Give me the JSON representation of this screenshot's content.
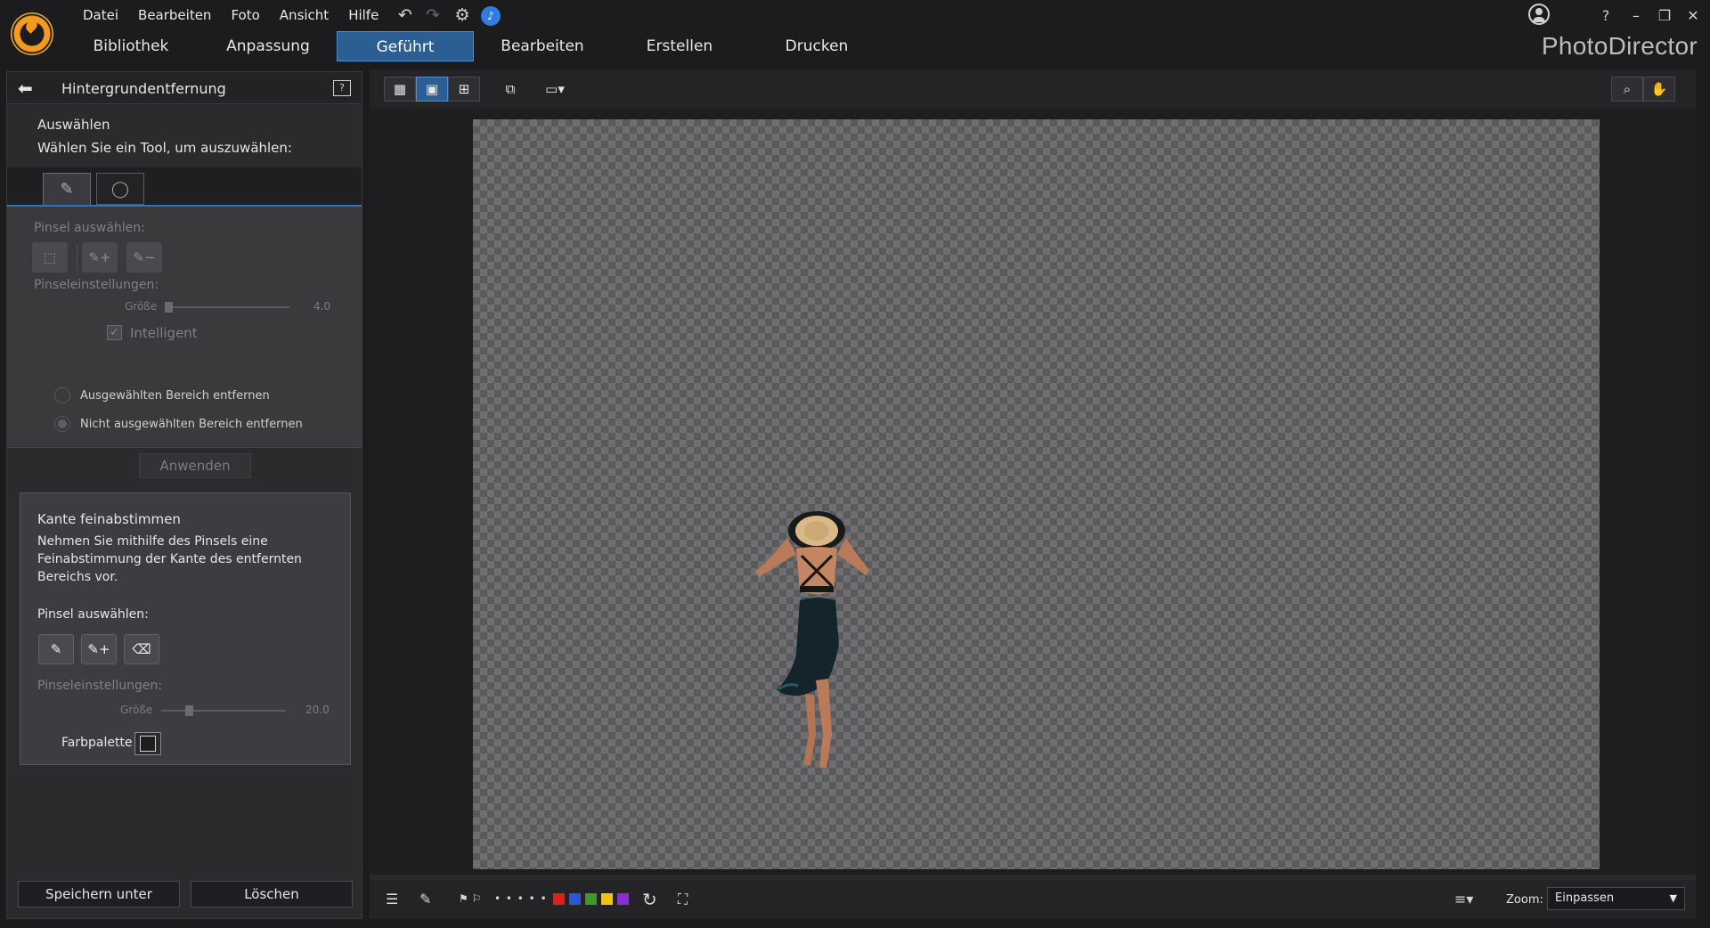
{
  "app": {
    "brand": "PhotoDirector",
    "menu": [
      "Datei",
      "Bearbeiten",
      "Foto",
      "Ansicht",
      "Hilfe"
    ],
    "tabs": [
      "Bibliothek",
      "Anpassung",
      "Geführt",
      "Bearbeiten",
      "Erstellen",
      "Drucken"
    ],
    "active_tab": "Geführt",
    "help_glyph": "?",
    "accent_color": "#2b5e93"
  },
  "panel": {
    "title": "Hintergrundentfernung",
    "select_heading": "Auswählen",
    "select_prompt": "Wählen Sie ein Tool, um auszuwählen:",
    "brush_select_label": "Pinsel auswählen:",
    "brush_settings_label": "Pinseleinstellungen:",
    "size_label": "Größe",
    "size_value": "4.0",
    "intelligent_label": "Intelligent",
    "radio_remove_selected": "Ausgewählten Bereich entfernen",
    "radio_remove_unselected": "Nicht ausgewählten Bereich entfernen",
    "apply_label": "Anwenden",
    "refine": {
      "title": "Kante feinabstimmen",
      "description": "Nehmen Sie mithilfe des Pinsels eine Feinabstimmung der Kante des entfernten Bereichs vor.",
      "brush_select_label": "Pinsel auswählen:",
      "brush_settings_label": "Pinseleinstellungen:",
      "size_label": "Größe",
      "size_value": "20.0",
      "palette_label": "Farbpalette"
    },
    "save_as_label": "Speichern unter",
    "delete_label": "Löschen"
  },
  "statusbar": {
    "zoom_label": "Zoom:",
    "zoom_value": "Einpassen",
    "dots": "• • • • •",
    "color_labels": [
      "#e01e1e",
      "#2a56d8",
      "#3c9a2c",
      "#f2c20c",
      "#8a2ad8"
    ]
  }
}
